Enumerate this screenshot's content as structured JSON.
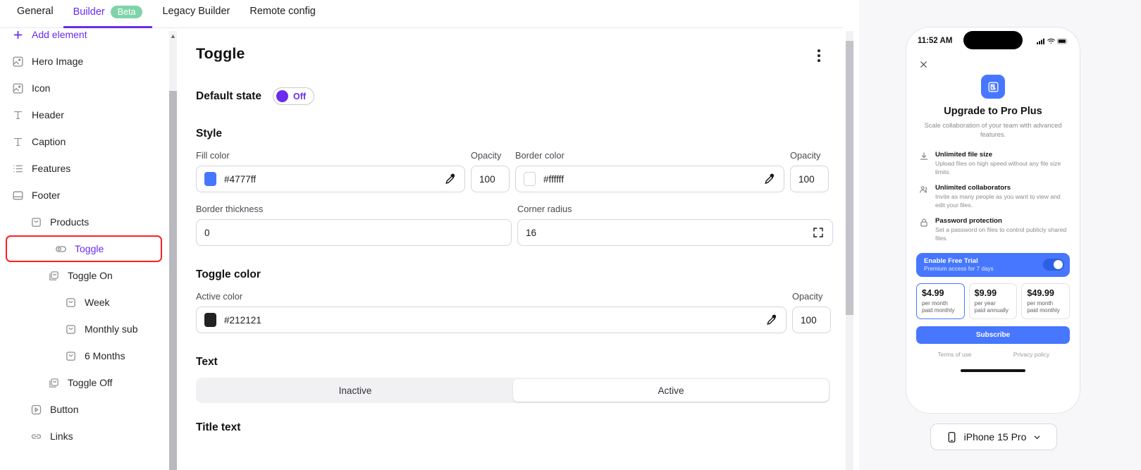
{
  "tabs": [
    {
      "label": "General",
      "active": false,
      "badge": null
    },
    {
      "label": "Builder",
      "active": true,
      "badge": "Beta"
    },
    {
      "label": "Legacy Builder",
      "active": false,
      "badge": null
    },
    {
      "label": "Remote config",
      "active": false,
      "badge": null
    }
  ],
  "sidebar": {
    "items": [
      {
        "label": "Add element",
        "icon": "plus-icon",
        "depth": 0,
        "state": "add"
      },
      {
        "label": "Hero Image",
        "icon": "image-icon",
        "depth": 0,
        "state": "normal"
      },
      {
        "label": "Icon",
        "icon": "image-icon",
        "depth": 0,
        "state": "normal"
      },
      {
        "label": "Header",
        "icon": "text-icon",
        "depth": 0,
        "state": "normal"
      },
      {
        "label": "Caption",
        "icon": "text-icon",
        "depth": 0,
        "state": "normal"
      },
      {
        "label": "Features",
        "icon": "list-icon",
        "depth": 0,
        "state": "normal"
      },
      {
        "label": "Footer",
        "icon": "footer-icon",
        "depth": 0,
        "state": "normal"
      },
      {
        "label": "Products",
        "icon": "container-icon",
        "depth": 1,
        "state": "normal"
      },
      {
        "label": "Toggle",
        "icon": "toggle-icon",
        "depth": 2,
        "state": "selected"
      },
      {
        "label": "Toggle On",
        "icon": "stack-icon",
        "depth": 2,
        "state": "normal"
      },
      {
        "label": "Week",
        "icon": "container-icon",
        "depth": 3,
        "state": "normal"
      },
      {
        "label": "Monthly sub",
        "icon": "container-icon",
        "depth": 3,
        "state": "normal"
      },
      {
        "label": "6 Months",
        "icon": "container-icon",
        "depth": 3,
        "state": "normal"
      },
      {
        "label": "Toggle Off",
        "icon": "stack-icon",
        "depth": 2,
        "state": "normal"
      },
      {
        "label": "Button",
        "icon": "button-icon",
        "depth": 1,
        "state": "normal"
      },
      {
        "label": "Links",
        "icon": "link-icon",
        "depth": 1,
        "state": "normal"
      }
    ]
  },
  "panel": {
    "title": "Toggle",
    "menu_icon": "kebab-menu-icon",
    "default_state": {
      "label": "Default state",
      "value": "Off"
    },
    "style": {
      "heading": "Style",
      "fill_color": {
        "label": "Fill color",
        "value": "#4777ff",
        "swatch": "#4777ff"
      },
      "fill_opacity": {
        "label": "Opacity",
        "value": "100"
      },
      "border_color": {
        "label": "Border color",
        "value": "#ffffff",
        "swatch": "#ffffff"
      },
      "border_opacity": {
        "label": "Opacity",
        "value": "100"
      },
      "border_thickness": {
        "label": "Border thickness",
        "value": "0"
      },
      "corner_radius": {
        "label": "Corner radius",
        "value": "16"
      }
    },
    "toggle_color": {
      "heading": "Toggle color",
      "active_color": {
        "label": "Active color",
        "value": "#212121",
        "swatch": "#212121"
      },
      "active_opacity": {
        "label": "Opacity",
        "value": "100"
      }
    },
    "text": {
      "heading": "Text",
      "segments": [
        {
          "label": "Inactive",
          "selected": false
        },
        {
          "label": "Active",
          "selected": true
        }
      ]
    },
    "title_text_heading": "Title text"
  },
  "preview": {
    "status": {
      "time": "11:52 AM",
      "island_label": "island"
    },
    "close_icon": "close-icon",
    "app_icon": "app-logo-icon",
    "title": "Upgrade to Pro Plus",
    "subtitle": "Scale collaboration of your team with advanced features.",
    "features": [
      {
        "icon": "download-icon",
        "title": "Unlimited file size",
        "desc": "Upload files on high speed without any file size limits."
      },
      {
        "icon": "people-icon",
        "title": "Unlimited collaborators",
        "desc": "Invite as many people as you want to view and edit your files."
      },
      {
        "icon": "lock-icon",
        "title": "Password protection",
        "desc": "Set a password on files to control publicly shared files."
      }
    ],
    "trial": {
      "title": "Enable Free Trial",
      "desc": "Premium access for 7 days",
      "enabled": true
    },
    "plans": [
      {
        "price": "$4.99",
        "line1": "per month",
        "line2": "paid monthly",
        "selected": true
      },
      {
        "price": "$9.99",
        "line1": "per year",
        "line2": "paid annually",
        "selected": false
      },
      {
        "price": "$49.99",
        "line1": "per month",
        "line2": "paid monthly",
        "selected": false
      }
    ],
    "subscribe_label": "Subscribe",
    "legal": [
      {
        "label": "Terms of use"
      },
      {
        "label": "Privacy policy"
      }
    ],
    "device": {
      "label": "iPhone 15 Pro",
      "icon": "phone-icon",
      "chevron": "chevron-down-icon"
    }
  },
  "colors": {
    "accent_purple": "#6a2bf0",
    "accent_blue": "#4777ff",
    "beta_green": "#7ed4a8",
    "annotation_red": "#ff2020"
  }
}
